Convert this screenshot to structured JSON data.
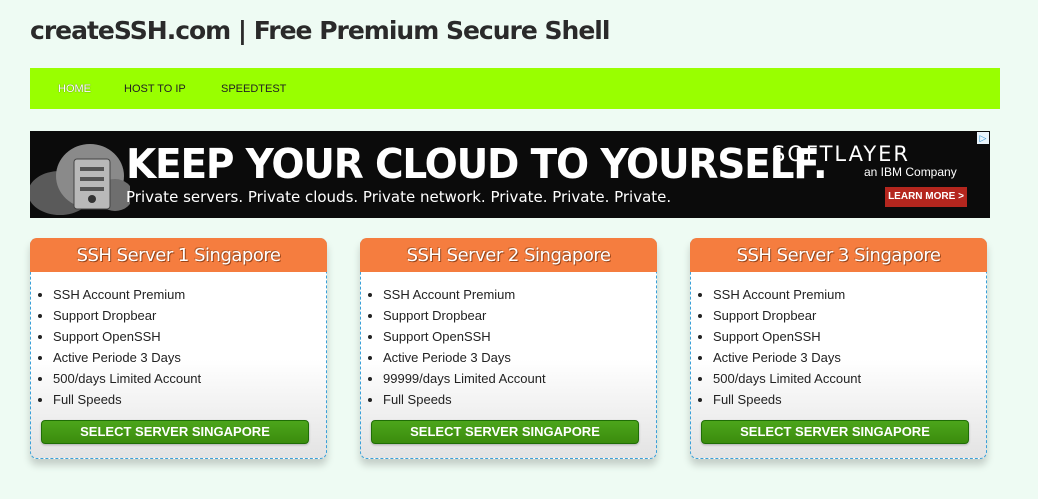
{
  "header": {
    "title": "createSSH.com | Free Premium Secure Shell"
  },
  "nav": {
    "items": [
      {
        "label": "HOME",
        "active": true
      },
      {
        "label": "HOST TO IP",
        "active": false
      },
      {
        "label": "SPEEDTEST",
        "active": false
      }
    ],
    "background_color": "#99ff00"
  },
  "ad": {
    "headline": "KEEP YOUR CLOUD TO YOURSELF.",
    "tagline": "Private servers. Private clouds. Private network. Private. Private. Private.",
    "brand": "SOFTLAYER",
    "brand_sub": "an IBM Company",
    "cta": "LEARN MORE >",
    "choices_icon": "adchoices-icon"
  },
  "cards": [
    {
      "title": "SSH Server 1 Singapore",
      "features": [
        "SSH Account Premium",
        "Support Dropbear",
        "Support OpenSSH",
        "Active Periode 3 Days",
        "500/days Limited Account",
        "Full Speeds"
      ],
      "button": "SELECT SERVER SINGAPORE"
    },
    {
      "title": "SSH Server 2 Singapore",
      "features": [
        "SSH Account Premium",
        "Support Dropbear",
        "Support OpenSSH",
        "Active Periode 3 Days",
        "99999/days Limited Account",
        "Full Speeds"
      ],
      "button": "SELECT SERVER SINGAPORE"
    },
    {
      "title": "SSH Server 3 Singapore",
      "features": [
        "SSH Account Premium",
        "Support Dropbear",
        "Support OpenSSH",
        "Active Periode 3 Days",
        "500/days Limited Account",
        "Full Speeds"
      ],
      "button": "SELECT SERVER SINGAPORE"
    }
  ],
  "colors": {
    "card_header": "#f57d3f",
    "select_button": "#3f940f",
    "card_border": "#3aa0d8"
  }
}
